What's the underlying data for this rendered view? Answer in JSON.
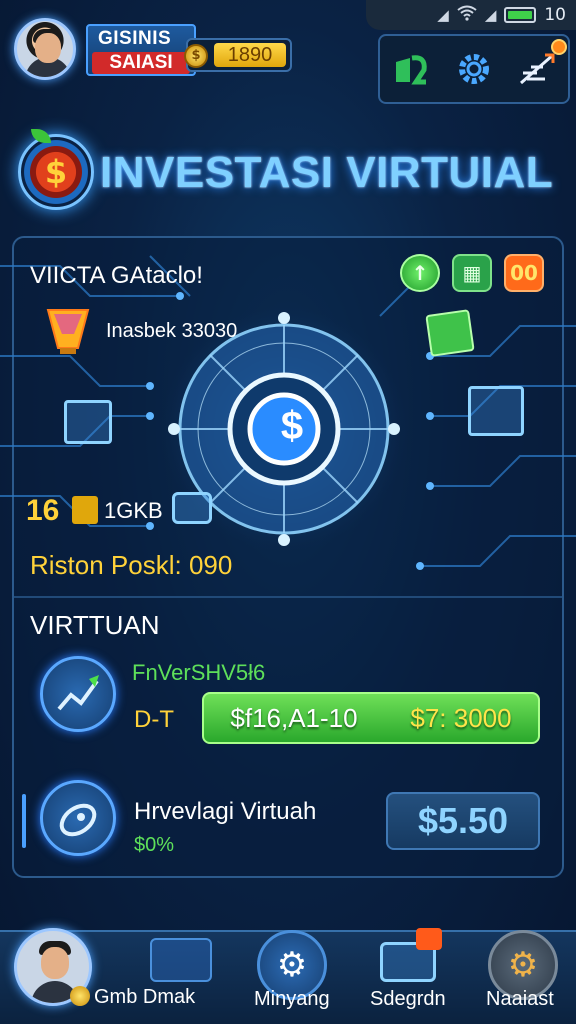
{
  "status_bar": {
    "time": "10"
  },
  "profile": {
    "name_top": "GISINIS",
    "name_bottom": "SAIASI",
    "coins": "1890",
    "coin_symbol": "$"
  },
  "title": "INVESTASI VIRTUIAL",
  "title_emblem_symbol": "$",
  "main": {
    "header_label": "VIICTA GAtaclo!",
    "trophy_text": "Inasbek 33030",
    "currency_amount": "16",
    "currency_unit": "1GKB",
    "points_text": "Riston Poskl: 090",
    "top_buttons": [
      "↑",
      "▦",
      "00"
    ],
    "hologram_symbol": "$"
  },
  "section": {
    "title": "VIRTTUAN",
    "row1": {
      "name": "FnVerSHV5ł6",
      "left_label": "D-T",
      "bar_left": "$f16,A1-10",
      "bar_right": "$7: 3000"
    },
    "row2": {
      "title": "Hrvevlagi Virtuah",
      "subtitle": "$0%",
      "price": "$5.50"
    }
  },
  "bottom_nav": [
    {
      "label": "Gmb Dmak"
    },
    {
      "label": "Minyang"
    },
    {
      "label": "Sdegrdn"
    },
    {
      "label": "Naaiast"
    }
  ],
  "colors": {
    "accent_blue": "#5aa8ff",
    "gold": "#ffd23a",
    "green": "#5ee05a",
    "red": "#d22a2a"
  }
}
